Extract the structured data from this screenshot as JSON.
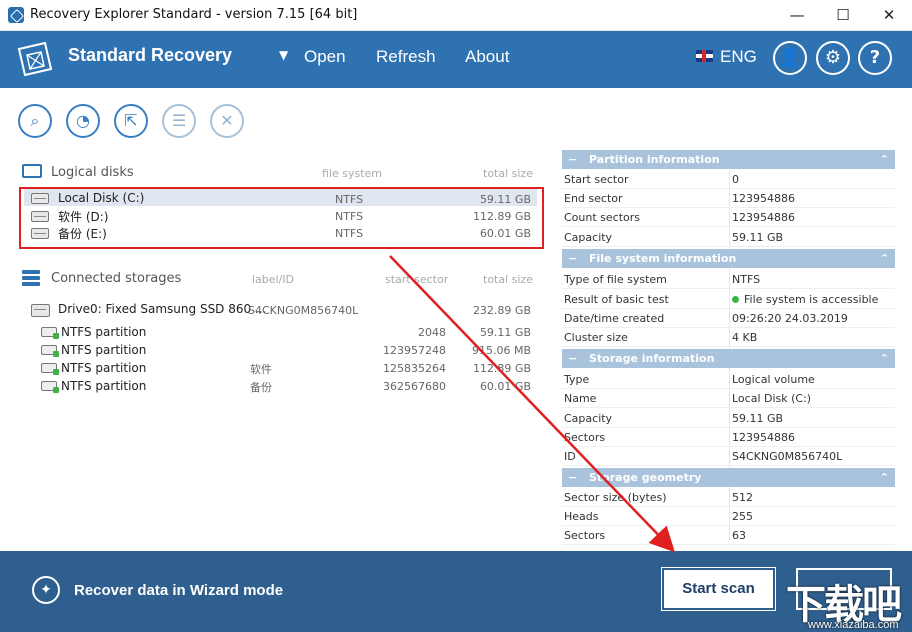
{
  "window": {
    "title": "Recovery Explorer Standard - version 7.15 [64 bit]",
    "min": "—",
    "max": "☐",
    "close": "✕"
  },
  "header": {
    "brand": "Standard Recovery",
    "dropdown": "▼",
    "nav": {
      "open": "Open",
      "refresh": "Refresh",
      "about": "About"
    },
    "lang": "ENG",
    "user_glyph": "👤",
    "gear_glyph": "⚙",
    "help_glyph": "?"
  },
  "toolbar": {
    "tools": [
      {
        "name": "search-icon",
        "glyph": "⌕"
      },
      {
        "name": "chart-icon",
        "glyph": "◔"
      },
      {
        "name": "export-icon",
        "glyph": "⇱"
      },
      {
        "name": "list-icon",
        "glyph": "☰"
      },
      {
        "name": "close-icon",
        "glyph": "✕"
      }
    ]
  },
  "logical_disks": {
    "title": "Logical disks",
    "col_fs": "file system",
    "col_size": "total size",
    "rows": [
      {
        "name": "Local Disk (C:)",
        "fs": "NTFS",
        "size": "59.11 GB"
      },
      {
        "name": "软件 (D:)",
        "fs": "NTFS",
        "size": "112.89 GB"
      },
      {
        "name": "备份 (E:)",
        "fs": "NTFS",
        "size": "60.01 GB"
      }
    ]
  },
  "connected_storages": {
    "title": "Connected storages",
    "col_label": "label/ID",
    "col_sector": "start sector",
    "col_size": "total size",
    "drive": {
      "name": "Drive0: Fixed Samsung SSD 860 ...",
      "id": "S4CKNG0M856740L",
      "size": "232.89 GB"
    },
    "partitions": [
      {
        "name": "NTFS partition",
        "label": "",
        "sector": "2048",
        "size": "59.11 GB"
      },
      {
        "name": "NTFS partition",
        "label": "",
        "sector": "123957248",
        "size": "915.06 MB"
      },
      {
        "name": "NTFS partition",
        "label": "软件",
        "sector": "125835264",
        "size": "112.89 GB"
      },
      {
        "name": "NTFS partition",
        "label": "备份",
        "sector": "362567680",
        "size": "60.01 GB"
      }
    ]
  },
  "right_panel": {
    "partition_info": {
      "title": "Partition information",
      "rows": [
        {
          "k": "Start sector",
          "v": "0"
        },
        {
          "k": "End sector",
          "v": "123954886"
        },
        {
          "k": "Count sectors",
          "v": "123954886"
        },
        {
          "k": "Capacity",
          "v": "59.11 GB"
        }
      ]
    },
    "fs_info": {
      "title": "File system information",
      "rows": [
        {
          "k": "Type of file system",
          "v": "NTFS"
        },
        {
          "k": "Result of basic test",
          "v": "File system is accessible"
        },
        {
          "k": "Date/time created",
          "v": "09:26:20 24.03.2019"
        },
        {
          "k": "Cluster size",
          "v": "4 KB"
        }
      ]
    },
    "storage_info": {
      "title": "Storage information",
      "rows": [
        {
          "k": "Type",
          "v": "Logical volume"
        },
        {
          "k": "Name",
          "v": "Local Disk (C:)"
        },
        {
          "k": "Capacity",
          "v": "59.11 GB"
        },
        {
          "k": "Sectors",
          "v": "123954886"
        },
        {
          "k": "ID",
          "v": "S4CKNG0M856740L"
        }
      ]
    },
    "storage_geometry": {
      "title": "Storage geometry",
      "rows": [
        {
          "k": "Sector size (bytes)",
          "v": "512"
        },
        {
          "k": "Heads",
          "v": "255"
        },
        {
          "k": "Sectors",
          "v": "63"
        }
      ]
    },
    "chevron": "⌃"
  },
  "footer": {
    "wizard_label": "Recover data in Wizard mode",
    "wand_glyph": "✦",
    "start_scan": "Start scan"
  },
  "watermark": {
    "text": "下载吧",
    "url": "www.xiazaiba.com"
  },
  "colors": {
    "header": "#2f72b2",
    "footer": "#2f5f8e",
    "section_head": "#a9c3dc",
    "annotation": "#e02020"
  }
}
